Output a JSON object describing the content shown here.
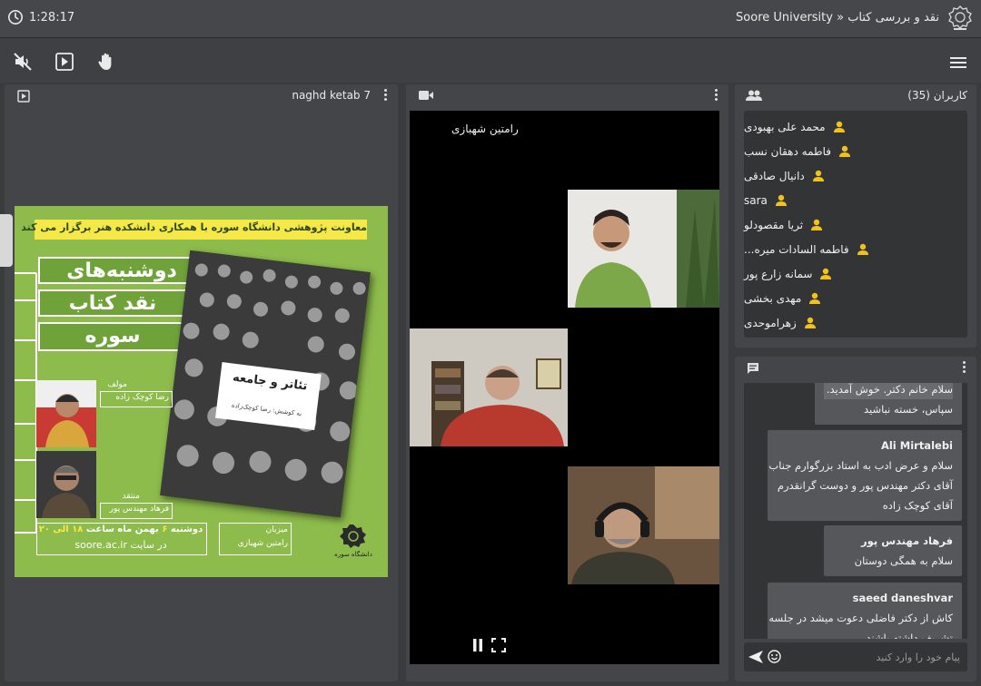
{
  "topbar": {
    "timer": "1:28:17",
    "title": "Soore University » نقد و بررسی کتاب"
  },
  "toolbar": {
    "icons": [
      "mute-audio-icon",
      "play-media-icon",
      "raise-hand-icon",
      "hamburger-menu-icon"
    ]
  },
  "presentation": {
    "title": "naghd ketab 7",
    "poster": {
      "header": "معاونت پژوهشی دانشگاه سوره با همکاری دانشکده هنر برگزار می کند",
      "series_line1": "دوشنبه‌های",
      "series_line2": "نقد کتاب",
      "series_line3": "سوره",
      "book_title": "تئاتر و جامعه",
      "book_sub": "به کوشش: رضا کوچک‌زاده",
      "author_role": "مولف",
      "author_name": "رضا کوچک زاده",
      "critic_role": "منتقد",
      "critic_name": "فرهاد مهندس پور",
      "date_line_pre": "دوشنبه ",
      "date_day": "۶",
      "date_line_mid": " بهمن ماه ساعت ",
      "date_time": "۱۸ الی ۲۰",
      "site_prefix": "در سایت",
      "site": "soore.ac.ir",
      "host_role": "میزبان",
      "host_name": "رامتین شهبازی",
      "logo_text": "دانشگاه سوره"
    }
  },
  "video": {
    "speaker_label": "رامتین شهبازی"
  },
  "users": {
    "header": "کاربران (35)",
    "items": [
      "محمد علی بهبودی",
      "فاطمه دهقان نسب",
      "دانیال صادقی",
      "sara",
      "ثریا مقصودلو",
      "فاطمه السادات میره...",
      "سمانه زارع پور",
      "مهدی بخشی",
      "زهراموحدی"
    ]
  },
  "chat": {
    "messages": [
      {
        "author": "",
        "lines": [
          "سلام خانم دکتر. خوش آمدید.",
          "سپاس، خسته نباشید"
        ]
      },
      {
        "author": "Ali Mirtalebi",
        "lines": [
          "سلام و عرض ادب به استاد بزرگوارم جناب",
          "آقای دکتر مهندس پور و دوست گرانقدرم",
          "آقای کوچک زاده"
        ]
      },
      {
        "author": "فرهاد مهندس پور",
        "lines": [
          "سلام به همگی دوستان"
        ]
      },
      {
        "author": "saeed daneshvar",
        "lines": [
          "کاش از دکتر فاضلی دعوت میشد در جلسه",
          "تشریف داشته باشند"
        ]
      }
    ],
    "input_placeholder": "پیام خود را وارد کنید"
  },
  "colors": {
    "background": "#3a3b3d",
    "panel": "#444548",
    "list_bg": "#333436",
    "user_icon": "#f2c21b",
    "poster_green": "#8dbb4c",
    "poster_yellow": "#f7e84a"
  }
}
